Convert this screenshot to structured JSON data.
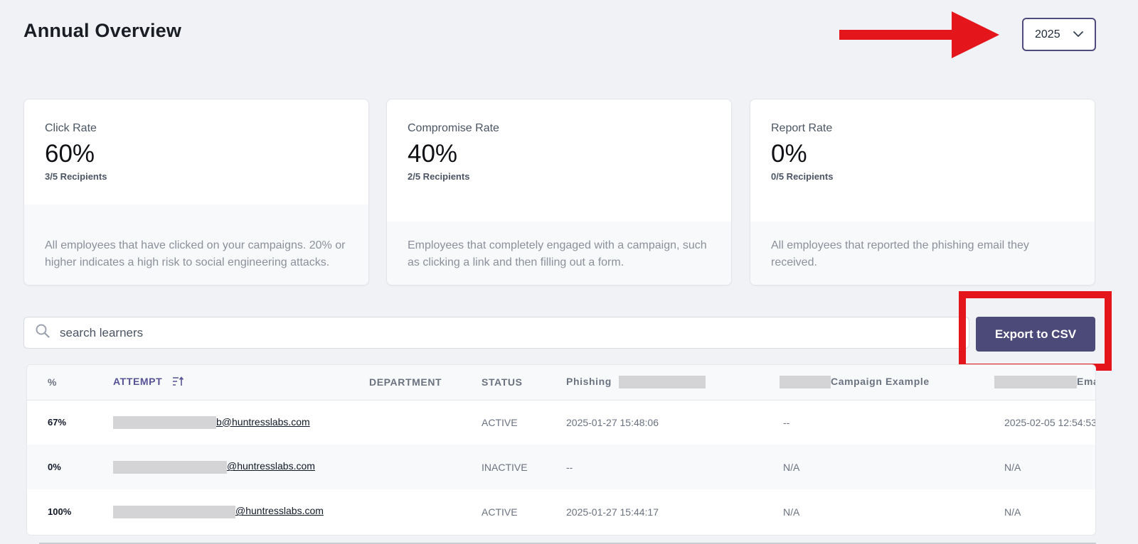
{
  "page": {
    "title": "Annual Overview"
  },
  "year_select": {
    "value": "2025",
    "icon": "chevron-down-icon"
  },
  "annotation": {
    "color": "#e4161c"
  },
  "stats": [
    {
      "label": "Click Rate",
      "value": "60%",
      "sub": "3/5 Recipients",
      "description": "All employees that have clicked on your campaigns. 20% or higher indicates a high risk to social engineering attacks."
    },
    {
      "label": "Compromise Rate",
      "value": "40%",
      "sub": "2/5 Recipients",
      "description": "Employees that completely engaged with a campaign, such as clicking a link and then filling out a form."
    },
    {
      "label": "Report Rate",
      "value": "0%",
      "sub": "0/5 Recipients",
      "description": "All employees that reported the phishing email they received."
    }
  ],
  "search": {
    "placeholder": "search learners",
    "icon": "search-icon"
  },
  "export": {
    "label": "Export to CSV",
    "color": "#4c4a79"
  },
  "table": {
    "columns": {
      "pct": "%",
      "attempt": "ATTEMPT",
      "department": "DEPARTMENT",
      "status": "STATUS",
      "col5": "Phishing",
      "col6": "Campaign Example",
      "col7": "Ema"
    },
    "rows": [
      {
        "pct": "67%",
        "email": "b@huntresslabs.com",
        "department": "",
        "status": "ACTIVE",
        "col5": "2025-01-27 15:48:06",
        "col6": "--",
        "col7": "2025-02-05 12:54:53"
      },
      {
        "pct": "0%",
        "email": "@huntresslabs.com",
        "department": "",
        "status": "INACTIVE",
        "col5": "--",
        "col6": "N/A",
        "col7": "N/A"
      },
      {
        "pct": "100%",
        "email": "@huntresslabs.com",
        "department": "",
        "status": "ACTIVE",
        "col5": "2025-01-27 15:44:17",
        "col6": "N/A",
        "col7": "N/A"
      }
    ]
  }
}
